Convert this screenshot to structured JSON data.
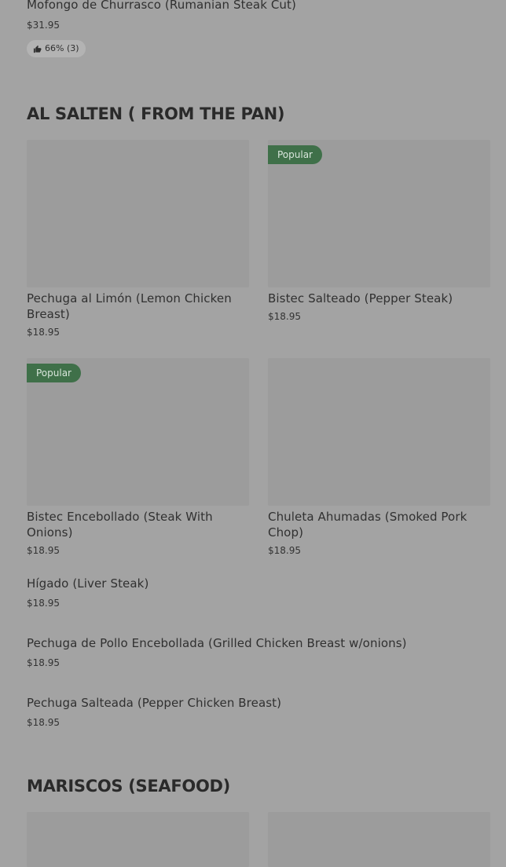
{
  "top_item": {
    "name": "Mofongo de Churrasco (Rumanian Steak Cut)",
    "price": "$31.95",
    "rating": "66% (3)"
  },
  "sections": [
    {
      "title": "AL SALTEN ( FROM THE PAN)",
      "cards": [
        {
          "name": "Pechuga al Limón (Lemon Chicken Breast)",
          "price": "$18.95",
          "badge": ""
        },
        {
          "name": "Bistec Salteado (Pepper Steak)",
          "price": "$18.95",
          "badge": "Popular"
        },
        {
          "name": "Bistec Encebollado (Steak With Onions)",
          "price": "$18.95",
          "badge": "Popular"
        },
        {
          "name": "Chuleta Ahumadas (Smoked Pork Chop)",
          "price": "$18.95",
          "badge": ""
        }
      ],
      "list": [
        {
          "name": "Hígado (Liver Steak)",
          "price": "$18.95"
        },
        {
          "name": "Pechuga de Pollo Encebollada (Grilled Chicken Breast w/onions)",
          "price": "$18.95"
        },
        {
          "name": "Pechuga Salteada (Pepper Chicken Breast)",
          "price": "$18.95"
        }
      ]
    },
    {
      "title": "MARISCOS (SEAFOOD)"
    }
  ],
  "colors": {
    "overlay_bg": "#a3a3a3",
    "badge_bg": "#3f7049",
    "image_placeholder": "#9c9c9c"
  }
}
